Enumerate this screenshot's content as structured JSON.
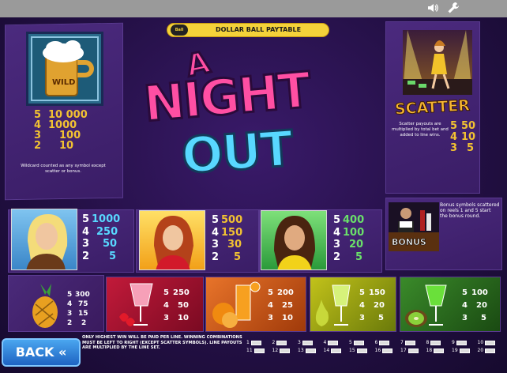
{
  "toolbar": {
    "sound_icon": "speaker-icon",
    "settings_icon": "wrench-icon"
  },
  "header": {
    "ball_badge": "Ball",
    "title": "DOLLAR BALL PAYTABLE"
  },
  "logo": {
    "line1": "A",
    "line2": "NIGHT",
    "line3": "OUT"
  },
  "wild": {
    "badge": "WILD",
    "payouts": [
      [
        "5",
        "10 000"
      ],
      [
        "4",
        "1000"
      ],
      [
        "3",
        "100"
      ],
      [
        "2",
        "10"
      ]
    ],
    "note": "Wildcard counted as any symbol except scatter or bonus."
  },
  "scatter": {
    "title": "SCATTER",
    "note": "Scatter payouts are multiplied by total bet and added to line wins.",
    "payouts": [
      [
        "5",
        "50"
      ],
      [
        "4",
        "10"
      ],
      [
        "3",
        "5"
      ]
    ]
  },
  "bonus": {
    "label": "BONUS",
    "note": "Bonus symbols scattered on reels 1 and 5 start the bonus round."
  },
  "girls": [
    {
      "payouts": [
        [
          "5",
          "1000"
        ],
        [
          "4",
          "250"
        ],
        [
          "3",
          "50"
        ],
        [
          "2",
          "5"
        ]
      ]
    },
    {
      "payouts": [
        [
          "5",
          "500"
        ],
        [
          "4",
          "150"
        ],
        [
          "3",
          "30"
        ],
        [
          "2",
          "5"
        ]
      ]
    },
    {
      "payouts": [
        [
          "5",
          "400"
        ],
        [
          "4",
          "100"
        ],
        [
          "3",
          "20"
        ],
        [
          "2",
          "5"
        ]
      ]
    }
  ],
  "drinks": [
    {
      "name": "pineapple",
      "payouts": [
        [
          "5",
          "300"
        ],
        [
          "4",
          "75"
        ],
        [
          "3",
          "15"
        ],
        [
          "2",
          "2"
        ]
      ]
    },
    {
      "name": "strawberry",
      "payouts": [
        [
          "5",
          "250"
        ],
        [
          "4",
          "50"
        ],
        [
          "3",
          "10"
        ]
      ]
    },
    {
      "name": "orange",
      "payouts": [
        [
          "5",
          "200"
        ],
        [
          "4",
          "25"
        ],
        [
          "3",
          "10"
        ]
      ]
    },
    {
      "name": "pear",
      "payouts": [
        [
          "5",
          "150"
        ],
        [
          "4",
          "20"
        ],
        [
          "3",
          "5"
        ]
      ]
    },
    {
      "name": "kiwi",
      "payouts": [
        [
          "5",
          "100"
        ],
        [
          "4",
          "20"
        ],
        [
          "3",
          "5"
        ]
      ]
    }
  ],
  "footer": {
    "back_label": "BACK «",
    "rules": "ONLY HIGHEST WIN WILL BE PAID PER LINE. WINNING COMBINATIONS MUST BE LEFT TO RIGHT (EXCEPT SCATTER SYMBOLS). LINE PAYOUTS ARE MULTIPLIED BY THE LINE SET."
  },
  "paylines": [
    "1",
    "2",
    "3",
    "4",
    "5",
    "6",
    "7",
    "8",
    "9",
    "10",
    "11",
    "12",
    "13",
    "14",
    "15",
    "16",
    "17",
    "18",
    "19",
    "20"
  ],
  "colors": {
    "gold": "#f2c232",
    "pink": "#ff4fa3",
    "cyan": "#58d8ff",
    "scatter_gold": "#f7b733",
    "back_blue": "#2a7fe0"
  }
}
